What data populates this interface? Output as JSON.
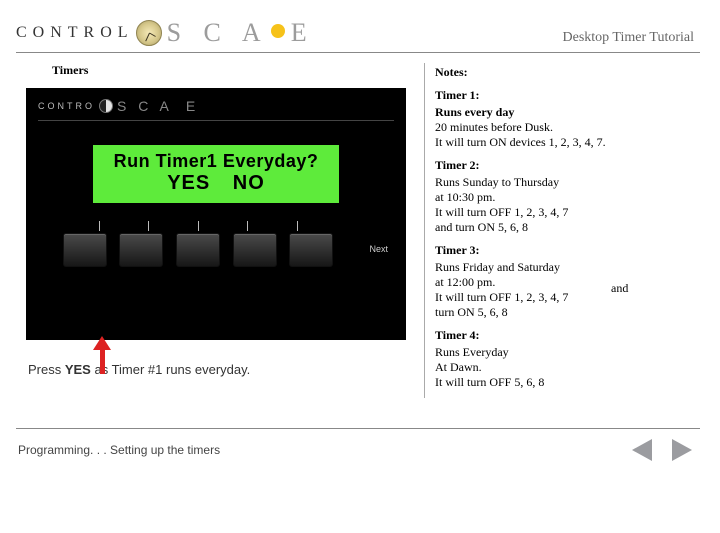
{
  "header": {
    "logo_control": "CONTROL",
    "logo_scape_left": "S C A",
    "logo_scape_right": "E",
    "page_title": "Desktop Timer Tutorial"
  },
  "left": {
    "section_heading": "Timers",
    "device": {
      "brand_control": "CONTRO",
      "brand_scape_left": "S C A",
      "brand_scape_right": "E",
      "lcd_question": "Run Timer1 Everyday?",
      "lcd_yes": "YES",
      "lcd_no": "NO",
      "next_label": "Next"
    },
    "instruction_prefix": "Press ",
    "instruction_bold": "YES",
    "instruction_suffix": " as Timer #1 runs everyday."
  },
  "notes": {
    "heading": "Notes:",
    "timer1_h": "Timer 1:",
    "timer1_bold": "Runs every day",
    "timer1_l2": "20 minutes before Dusk.",
    "timer1_l3": "It will turn ON devices 1, 2, 3, 4, 7.",
    "timer2_h": "Timer 2:",
    "timer2_l1": "Runs Sunday to Thursday",
    "timer2_l2": "at 10:30 pm.",
    "timer2_l3": "It will turn OFF 1, 2, 3, 4, 7",
    "timer2_l4": "and turn ON 5, 6, 8",
    "timer3_h": "Timer 3:",
    "timer3_l1": "Runs Friday and Saturday",
    "timer3_l2": "at 12:00 pm.",
    "timer3_l3": "It will turn OFF 1, 2, 3, 4, 7",
    "timer3_and": "and",
    "timer3_l4": "turn ON 5, 6, 8",
    "timer4_h": "Timer 4:",
    "timer4_l1": "Runs Everyday",
    "timer4_l2": "At Dawn.",
    "timer4_l3": "It will turn OFF 5, 6, 8"
  },
  "footer": {
    "text": "Programming. . . Setting up the timers"
  }
}
